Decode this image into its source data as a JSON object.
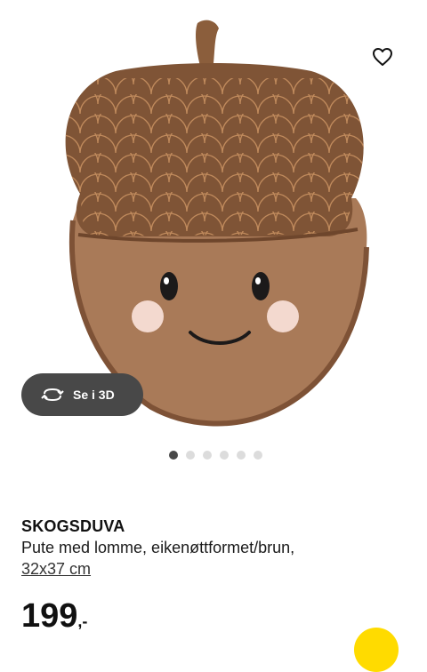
{
  "product": {
    "name": "SKOGSDUVA",
    "description": "Pute med lomme, eikenøttformet/brun,",
    "size": "32x37 cm",
    "price": "199",
    "price_suffix": ",-"
  },
  "viewer": {
    "view_3d_label": "Se i 3D",
    "image_count": 6,
    "active_image": 1
  },
  "icons": {
    "wishlist": "heart-icon",
    "view_3d": "rotate-3d-icon"
  },
  "colors": {
    "accent_dark": "#484848",
    "cart_yellow": "#ffdb00",
    "acorn_cap": "#8a5a3a",
    "acorn_body": "#a9785a"
  }
}
